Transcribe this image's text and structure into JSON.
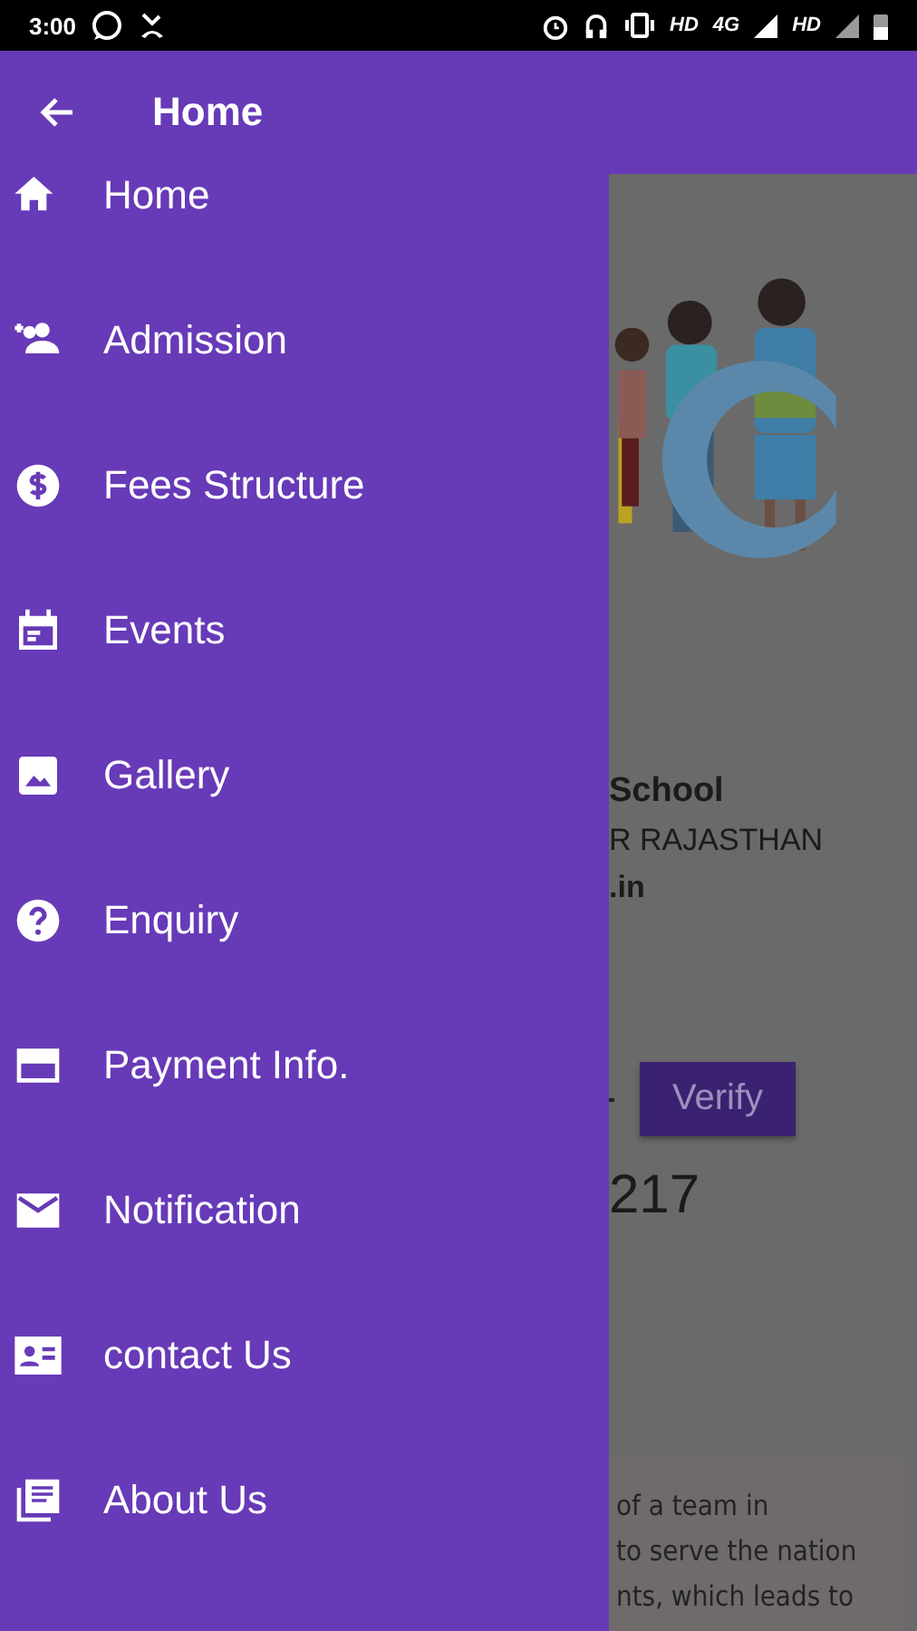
{
  "status_bar": {
    "time": "3:00",
    "network": [
      "HD",
      "4G",
      "HD"
    ]
  },
  "drawer": {
    "title": "Home",
    "items": [
      {
        "label": "Home"
      },
      {
        "label": "Admission"
      },
      {
        "label": "Fees Structure"
      },
      {
        "label": "Events"
      },
      {
        "label": "Gallery"
      },
      {
        "label": "Enquiry"
      },
      {
        "label": "Payment Info."
      },
      {
        "label": "Notification"
      },
      {
        "label": "contact Us"
      },
      {
        "label": "About Us"
      }
    ]
  },
  "page": {
    "school_name": "School",
    "address": "R RAJASTHAN",
    "website": ".in",
    "verify_button": "Verify",
    "number": "217",
    "about_lines": [
      "of a team in",
      "to serve the nation",
      "nts, which leads to"
    ]
  }
}
